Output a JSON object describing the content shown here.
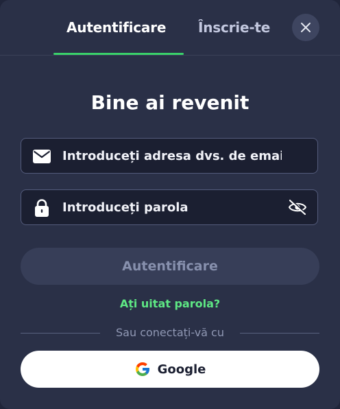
{
  "tabs": {
    "login_label": "Autentificare",
    "signup_label": "Înscrie-te"
  },
  "title": "Bine ai revenit",
  "email": {
    "placeholder": "Introduceți adresa dvs. de email",
    "value": ""
  },
  "password": {
    "placeholder": "Introduceți parola",
    "value": ""
  },
  "submit_label": "Autentificare",
  "forgot_label": "Ați uitat parola?",
  "divider_label": "Sau conectați-vă cu",
  "google_label": "Google",
  "icons": {
    "close": "close-icon",
    "email": "envelope-icon",
    "password": "lock-icon",
    "toggle": "eye-off-icon",
    "google": "google-logo-icon"
  },
  "colors": {
    "accent": "#3ad16a",
    "link": "#5ee884",
    "background": "#2a3047",
    "field": "#1b1f31"
  }
}
